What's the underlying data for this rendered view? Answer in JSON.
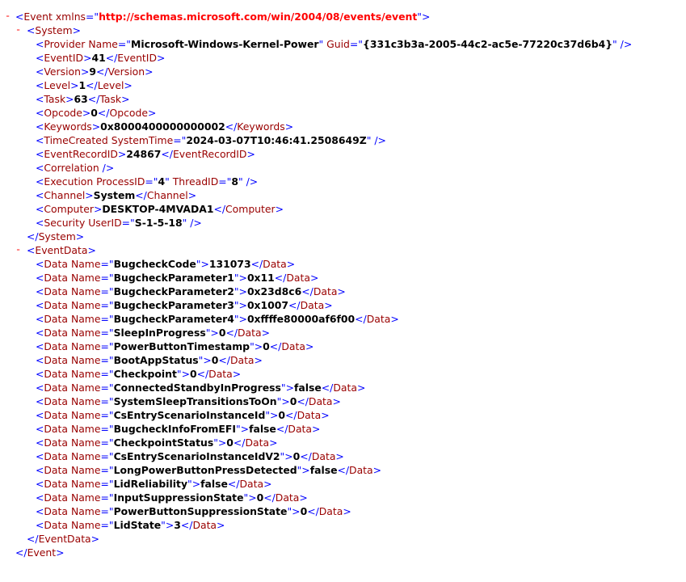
{
  "event": {
    "toggle": "-",
    "tag": "Event",
    "attr": "xmlns",
    "value": "http://schemas.microsoft.com/win/2004/08/events/event"
  },
  "system": {
    "toggle": "-",
    "tag": "System",
    "provider": {
      "tag": "Provider",
      "a1": "Name",
      "v1": "Microsoft-Windows-Kernel-Power",
      "a2": "Guid",
      "v2": "{331c3b3a-2005-44c2-ac5e-77220c37d6b4}"
    },
    "fields": [
      {
        "tag": "EventID",
        "text": "41"
      },
      {
        "tag": "Version",
        "text": "9"
      },
      {
        "tag": "Level",
        "text": "1"
      },
      {
        "tag": "Task",
        "text": "63"
      },
      {
        "tag": "Opcode",
        "text": "0"
      },
      {
        "tag": "Keywords",
        "text": "0x8000400000000002"
      }
    ],
    "time_created": {
      "tag": "TimeCreated",
      "a1": "SystemTime",
      "v1": "2024-03-07T10:46:41.2508649Z"
    },
    "record_id": {
      "tag": "EventRecordID",
      "text": "24867"
    },
    "correlation": {
      "tag": "Correlation"
    },
    "execution": {
      "tag": "Execution",
      "a1": "ProcessID",
      "v1": "4",
      "a2": "ThreadID",
      "v2": "8"
    },
    "channel": {
      "tag": "Channel",
      "text": "System"
    },
    "computer": {
      "tag": "Computer",
      "text": "DESKTOP-4MVADA1"
    },
    "security": {
      "tag": "Security",
      "a1": "UserID",
      "v1": "S-1-5-18"
    }
  },
  "eventdata": {
    "toggle": "-",
    "tag": "EventData",
    "data_tag": "Data",
    "data_attr": "Name",
    "items": [
      {
        "name": "BugcheckCode",
        "value": "131073"
      },
      {
        "name": "BugcheckParameter1",
        "value": "0x11"
      },
      {
        "name": "BugcheckParameter2",
        "value": "0x23d8c6"
      },
      {
        "name": "BugcheckParameter3",
        "value": "0x1007"
      },
      {
        "name": "BugcheckParameter4",
        "value": "0xffffe80000af6f00"
      },
      {
        "name": "SleepInProgress",
        "value": "0"
      },
      {
        "name": "PowerButtonTimestamp",
        "value": "0"
      },
      {
        "name": "BootAppStatus",
        "value": "0"
      },
      {
        "name": "Checkpoint",
        "value": "0"
      },
      {
        "name": "ConnectedStandbyInProgress",
        "value": "false"
      },
      {
        "name": "SystemSleepTransitionsToOn",
        "value": "0"
      },
      {
        "name": "CsEntryScenarioInstanceId",
        "value": "0"
      },
      {
        "name": "BugcheckInfoFromEFI",
        "value": "false"
      },
      {
        "name": "CheckpointStatus",
        "value": "0"
      },
      {
        "name": "CsEntryScenarioInstanceIdV2",
        "value": "0"
      },
      {
        "name": "LongPowerButtonPressDetected",
        "value": "false"
      },
      {
        "name": "LidReliability",
        "value": "false"
      },
      {
        "name": "InputSuppressionState",
        "value": "0"
      },
      {
        "name": "PowerButtonSuppressionState",
        "value": "0"
      },
      {
        "name": "LidState",
        "value": "3"
      }
    ]
  }
}
